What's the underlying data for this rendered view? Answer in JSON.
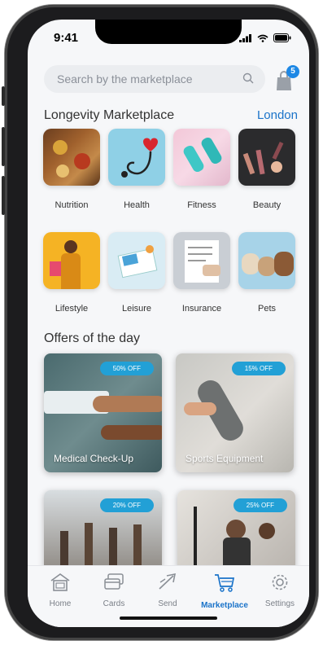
{
  "status": {
    "time": "9:41"
  },
  "search": {
    "placeholder": "Search by the marketplace"
  },
  "cart": {
    "count": "5"
  },
  "marketplace": {
    "title": "Longevity Marketplace",
    "city": "London",
    "categories": [
      {
        "label": "Nutrition"
      },
      {
        "label": "Health"
      },
      {
        "label": "Fitness"
      },
      {
        "label": "Beauty"
      },
      {
        "label": "Lifestyle"
      },
      {
        "label": "Leisure"
      },
      {
        "label": "Insurance"
      },
      {
        "label": "Pets"
      }
    ]
  },
  "offers": {
    "title": "Offers of the day",
    "items": [
      {
        "discount": "50% OFF",
        "title": "Medical Check-Up"
      },
      {
        "discount": "15% OFF",
        "title": "Sports Equipment"
      },
      {
        "discount": "20% OFF",
        "title": ""
      },
      {
        "discount": "25% OFF",
        "title": ""
      }
    ]
  },
  "nav": {
    "items": [
      {
        "label": "Home",
        "icon": "home-icon"
      },
      {
        "label": "Cards",
        "icon": "cards-icon"
      },
      {
        "label": "Send",
        "icon": "send-icon"
      },
      {
        "label": "Marketplace",
        "icon": "cart-icon"
      },
      {
        "label": "Settings",
        "icon": "gear-icon"
      }
    ],
    "active": "Marketplace"
  },
  "colors": {
    "accent": "#1a73c9",
    "badge": "#1e88e5",
    "pill": "#22a0d6"
  }
}
